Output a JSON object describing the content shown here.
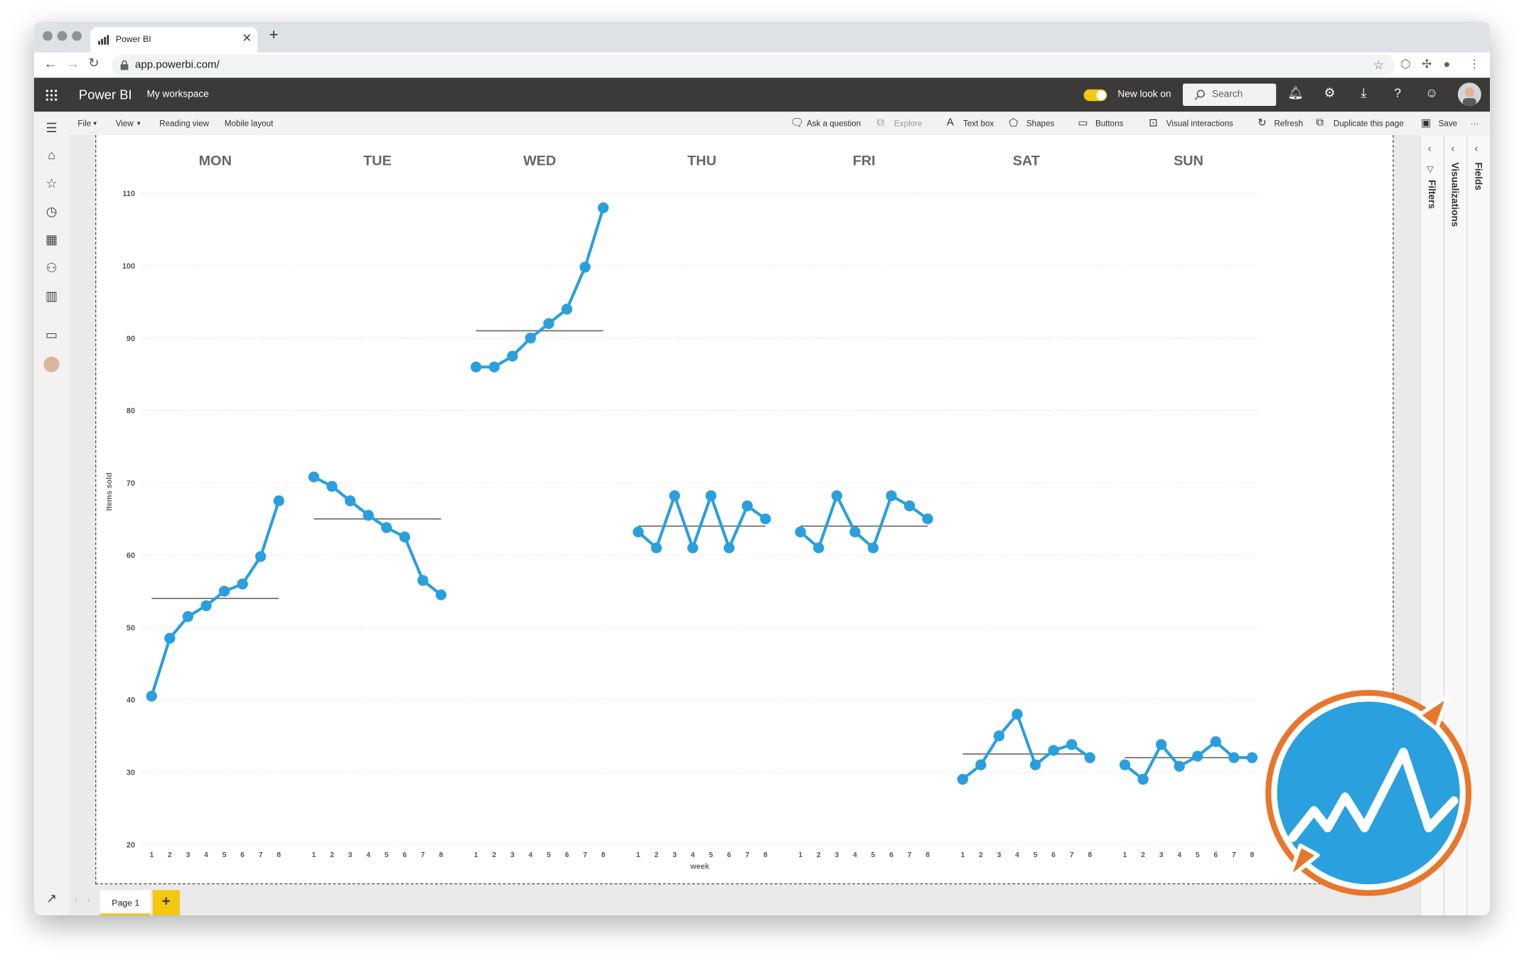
{
  "browser": {
    "tab_title": "Power BI",
    "url": "app.powerbi.com/"
  },
  "header": {
    "app_title": "Power BI",
    "workspace": "My workspace",
    "new_look_label": "New look on",
    "new_look_on": true,
    "search_placeholder": "Search"
  },
  "ribbon": {
    "file": "File",
    "view": "View",
    "reading_view": "Reading view",
    "mobile_layout": "Mobile layout",
    "ask_question": "Ask a question",
    "explore": "Explore",
    "text_box": "Text box",
    "shapes": "Shapes",
    "buttons": "Buttons",
    "visual_interactions": "Visual interactions",
    "refresh": "Refresh",
    "duplicate_page": "Duplicate this page",
    "save": "Save",
    "more": "···"
  },
  "panes": {
    "filters": "Filters",
    "visualizations": "Visualizations",
    "fields": "Fields"
  },
  "pages": {
    "tabs": [
      "Page 1"
    ],
    "add": "+"
  },
  "colors": {
    "series": "#2a9fdd",
    "mean_line": "#666666",
    "accent": "#f2c811",
    "header_bg": "#3b3a39",
    "logo_ring": "#e8762c"
  },
  "chart_data": {
    "type": "line",
    "title": "",
    "ylabel": "Items sold",
    "xlabel": "week",
    "ylim": [
      20,
      110
    ],
    "yticks": [
      20,
      30,
      40,
      50,
      60,
      70,
      80,
      90,
      100,
      110
    ],
    "x": [
      1,
      2,
      3,
      4,
      5,
      6,
      7,
      8
    ],
    "grid": true,
    "panels": [
      {
        "name": "MON",
        "values": [
          40.5,
          48.5,
          51.5,
          53,
          55,
          56,
          59.8,
          67.5
        ],
        "mean": 54
      },
      {
        "name": "TUE",
        "values": [
          70.8,
          69.5,
          67.5,
          65.5,
          63.8,
          62.5,
          56.5,
          54.5
        ],
        "mean": 65
      },
      {
        "name": "WED",
        "values": [
          86,
          86,
          87.5,
          90,
          92,
          94,
          99.8,
          108
        ],
        "mean": 91
      },
      {
        "name": "THU",
        "values": [
          63.2,
          61,
          68.2,
          61,
          68.2,
          61,
          66.8,
          65
        ],
        "mean": 64
      },
      {
        "name": "FRI",
        "values": [
          63.2,
          61,
          68.2,
          63.2,
          61,
          68.2,
          66.8,
          65
        ],
        "mean": 64
      },
      {
        "name": "SAT",
        "values": [
          29,
          31,
          35,
          38,
          31,
          33,
          33.8,
          32
        ],
        "mean": 32.5
      },
      {
        "name": "SUN",
        "values": [
          31,
          29,
          33.8,
          30.8,
          32.2,
          34.2,
          32,
          32
        ],
        "mean": 32
      }
    ]
  }
}
